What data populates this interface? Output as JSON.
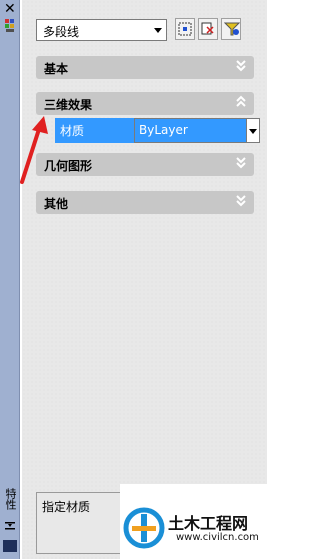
{
  "palette": {
    "title": "特性",
    "close_icon": "close-x-icon"
  },
  "toolbar": {
    "object_type": "多段线",
    "buttons": [
      "quick-select-icon",
      "select-objects-icon",
      "toggle-pickadd-icon"
    ]
  },
  "sections": [
    {
      "label": "基本",
      "state": "collapsed"
    },
    {
      "label": "三维效果",
      "state": "expanded"
    },
    {
      "label": "几何图形",
      "state": "collapsed"
    },
    {
      "label": "其他",
      "state": "collapsed"
    }
  ],
  "property": {
    "name": "材质",
    "value": "ByLayer"
  },
  "description": {
    "text": "指定材质"
  },
  "watermark": {
    "brand": "土木工程网",
    "url": "www.civilcn.com"
  },
  "colors": {
    "selection": "#3399ff",
    "section_header": "#c7c7c7",
    "annotation_arrow": "#e02020"
  }
}
